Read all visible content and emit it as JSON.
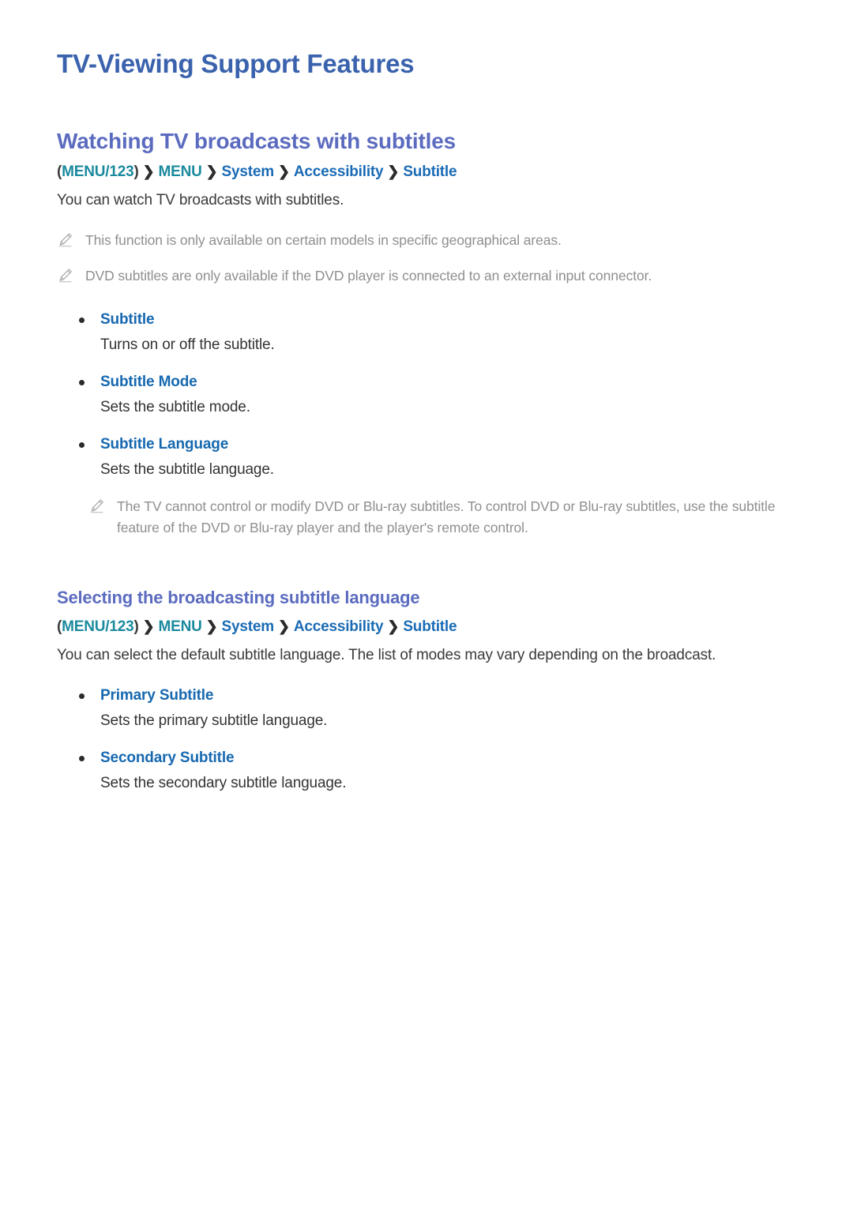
{
  "page": {
    "title": "TV-Viewing Support Features"
  },
  "sections": [
    {
      "heading": "Watching TV broadcasts with subtitles",
      "breadcrumb": {
        "open_paren": "(",
        "close_paren": ")",
        "separator": "❯",
        "items": [
          {
            "label": "MENU/123",
            "color": "teal"
          },
          {
            "label": "MENU",
            "color": "teal"
          },
          {
            "label": "System",
            "color": "blue"
          },
          {
            "label": "Accessibility",
            "color": "blue"
          },
          {
            "label": "Subtitle",
            "color": "blue"
          }
        ]
      },
      "intro": "You can watch TV broadcasts with subtitles.",
      "notes": [
        {
          "icon": "pencil-note-icon",
          "text": "This function is only available on certain models in specific geographical areas."
        },
        {
          "icon": "pencil-note-icon",
          "text": "DVD subtitles are only available if the DVD player is connected to an external input connector."
        }
      ],
      "options": [
        {
          "label": "Subtitle",
          "description": "Turns on or off the subtitle."
        },
        {
          "label": "Subtitle Mode",
          "description": "Sets the subtitle mode."
        },
        {
          "label": "Subtitle Language",
          "description": "Sets the subtitle language."
        }
      ],
      "footer_notes": [
        {
          "icon": "pencil-note-icon",
          "text": "The TV cannot control or modify DVD or Blu-ray subtitles. To control DVD or Blu-ray subtitles, use the subtitle feature of the DVD or Blu-ray player and the player's remote control."
        }
      ]
    },
    {
      "heading": "Selecting the broadcasting subtitle language",
      "breadcrumb": {
        "open_paren": "(",
        "close_paren": ")",
        "separator": "❯",
        "items": [
          {
            "label": "MENU/123",
            "color": "teal"
          },
          {
            "label": "MENU",
            "color": "teal"
          },
          {
            "label": "System",
            "color": "blue"
          },
          {
            "label": "Accessibility",
            "color": "blue"
          },
          {
            "label": "Subtitle",
            "color": "blue"
          }
        ]
      },
      "intro": "You can select the default subtitle language. The list of modes may vary depending on the broadcast.",
      "options": [
        {
          "label": "Primary Subtitle",
          "description": "Sets the primary subtitle language."
        },
        {
          "label": "Secondary Subtitle",
          "description": "Sets the secondary subtitle language."
        }
      ]
    }
  ],
  "colors": {
    "page_title": "#3a62ad",
    "section_heading": "#5b6bbf",
    "breadcrumb_teal": "#1b8a9e",
    "breadcrumb_blue": "#1a6bb5",
    "option_label": "#1668b0",
    "note_text": "#8f8f8f",
    "body_text": "#333333",
    "background": "#ffffff"
  }
}
